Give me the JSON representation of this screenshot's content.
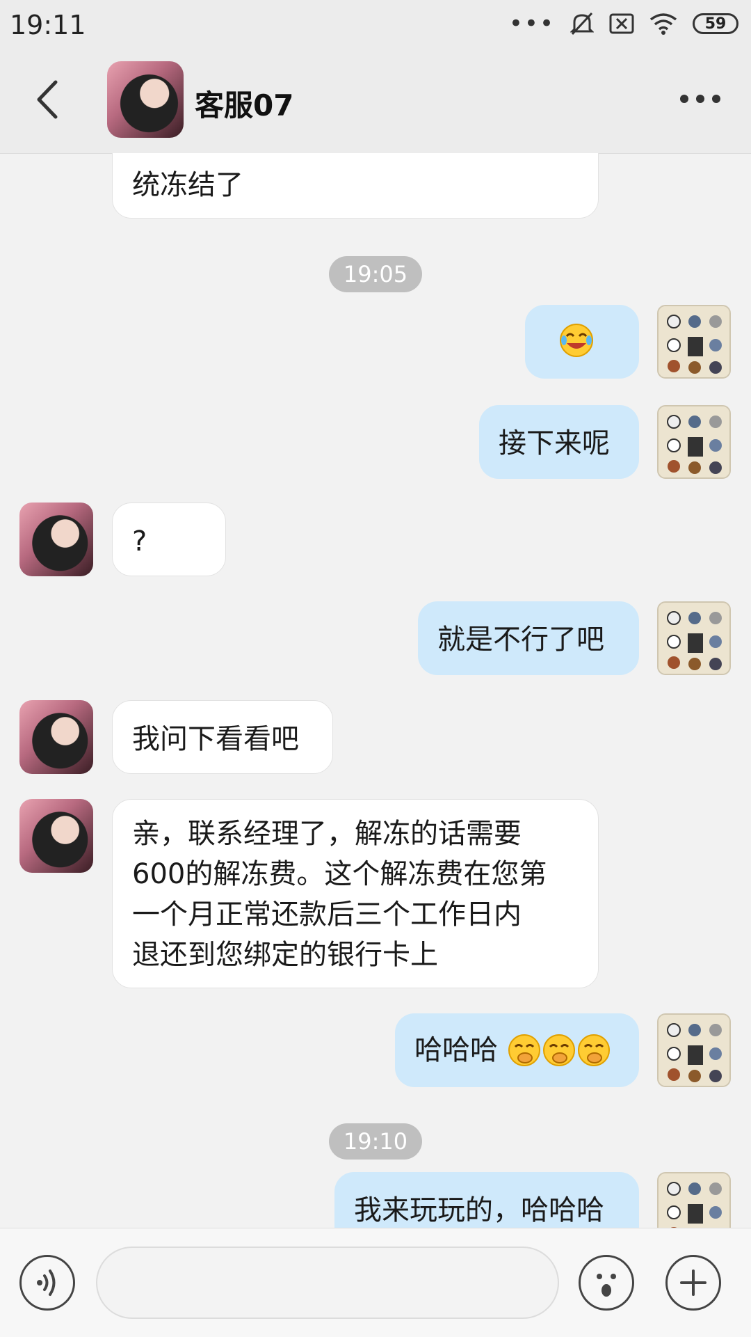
{
  "status_bar": {
    "time": "19:11",
    "battery": "59"
  },
  "header": {
    "title": "客服07"
  },
  "messages": [
    {
      "side": "left",
      "text": "统冻结了"
    },
    {
      "type": "time",
      "text": "19:05"
    },
    {
      "side": "right",
      "type": "emoji",
      "emoji": "laughing-tears-emoji"
    },
    {
      "side": "right",
      "text": "接下来呢"
    },
    {
      "side": "left",
      "text": "?"
    },
    {
      "side": "right",
      "text": "就是不行了吧"
    },
    {
      "side": "left",
      "text": "我问下看看吧"
    },
    {
      "side": "left",
      "lines": [
        "亲，联系经理了，解冻的话需要",
        "600的解冻费。这个解冻费在您第",
        "一个月正常还款后三个工作日内",
        "退还到您绑定的银行卡上"
      ]
    },
    {
      "side": "right",
      "text": "哈哈哈",
      "emojis": [
        "giggle-emoji",
        "giggle-emoji",
        "giggle-emoji"
      ]
    },
    {
      "type": "time",
      "text": "19:10"
    },
    {
      "side": "right",
      "text": "我来玩玩的，哈哈哈"
    }
  ],
  "input": {
    "placeholder": ""
  },
  "colors": {
    "bubble_mine": "#cfe9fb",
    "bubble_theirs": "#ffffff",
    "background": "#f2f2f2"
  }
}
